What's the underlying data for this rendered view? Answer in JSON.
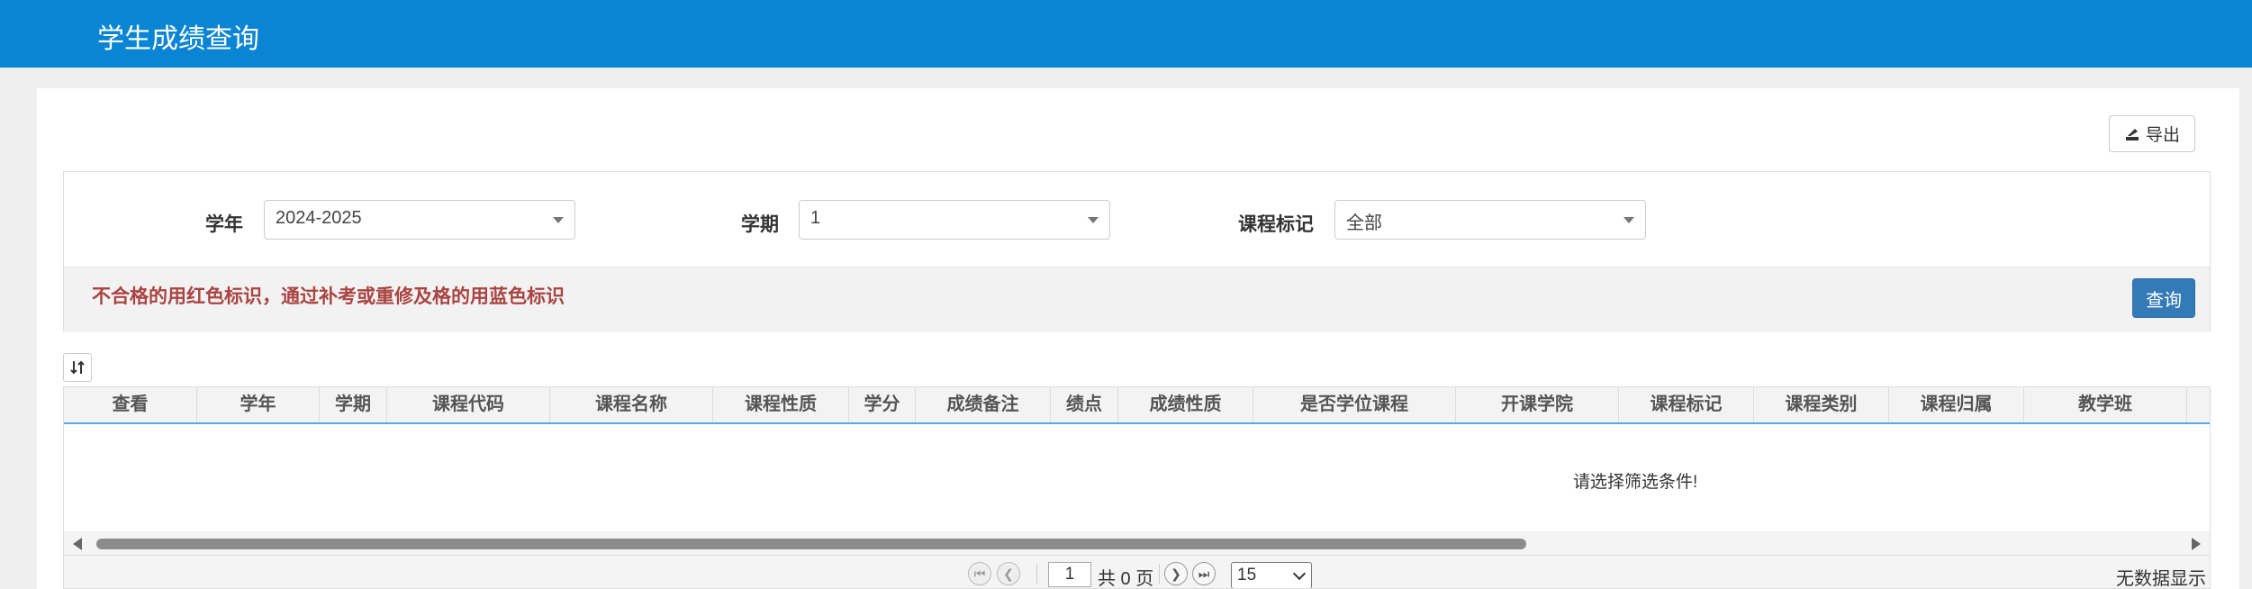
{
  "header": {
    "title": "学生成绩查询"
  },
  "toolbar": {
    "export_label": "导出",
    "export_icon": "export-icon"
  },
  "filters": {
    "year": {
      "label": "学年",
      "value": "2024-2025"
    },
    "term": {
      "label": "学期",
      "value": "1"
    },
    "course_mark": {
      "label": "课程标记",
      "value": "全部"
    },
    "note": "不合格的用红色标识，通过补考或重修及格的用蓝色标识",
    "query_label": "查询"
  },
  "grid": {
    "sort_icon": "sort-icon",
    "columns": [
      "查看",
      "学年",
      "学期",
      "课程代码",
      "课程名称",
      "课程性质",
      "学分",
      "成绩备注",
      "绩点",
      "成绩性质",
      "是否学位课程",
      "开课学院",
      "课程标记",
      "课程类别",
      "课程归属",
      "教学班"
    ],
    "empty_message": "请选择筛选条件!"
  },
  "pager": {
    "current_page": "1",
    "total_label": "共 0 页",
    "page_size": "15",
    "info": "无数据显示"
  },
  "colors": {
    "header_bg": "#0a85d3",
    "note_red": "#a94442",
    "query_btn": "#337ab7"
  }
}
